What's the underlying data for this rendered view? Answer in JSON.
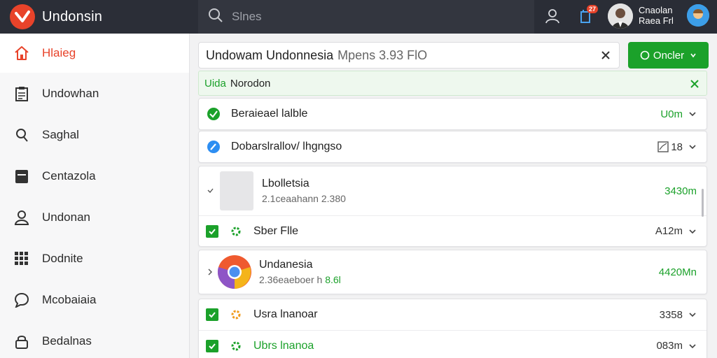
{
  "app": {
    "title": "Undonsin"
  },
  "search": {
    "placeholder": "Slnes"
  },
  "notifications": {
    "badge": "27"
  },
  "profile": {
    "line1": "Cnaolan",
    "line2": "Raea Frl"
  },
  "sidebar": {
    "items": [
      {
        "label": "Hlaieg",
        "icon": "home-icon",
        "active": true
      },
      {
        "label": "Undowhan",
        "icon": "clipboard-icon"
      },
      {
        "label": "Saghal",
        "icon": "search-icon"
      },
      {
        "label": "Centazola",
        "icon": "contacts-icon"
      },
      {
        "label": "Undonan",
        "icon": "user-icon"
      },
      {
        "label": "Dodnite",
        "icon": "grid-icon"
      },
      {
        "label": "Mcobaiaia",
        "icon": "chat-icon"
      },
      {
        "label": "Bedalnas",
        "icon": "lock-icon"
      }
    ]
  },
  "path_bar": {
    "name": "Undowam Undonnesia",
    "size": "Mpens 3.93 FlO"
  },
  "primary_button": {
    "label": "Oncler"
  },
  "notice": {
    "accent": "Uida",
    "text": "Norodon"
  },
  "rows": {
    "r1": {
      "label": "Beraieael lalble",
      "value": "U0m"
    },
    "r2": {
      "label": "Dobarslrallov/ lhgngso",
      "value": "18"
    },
    "r3": {
      "title": "Lbolletsia",
      "subtitle": "2.1ceaahann 2.380",
      "value": "3430m"
    },
    "r4": {
      "label": "Sber Flle",
      "value": "A12m"
    },
    "r5": {
      "title": "Undanesia",
      "subtitle_a": "2.36eaeboer h",
      "subtitle_b": "8.6l",
      "value": "4420Mn"
    },
    "r6": {
      "label": "Usra lnanoar",
      "value": "3358"
    },
    "r7": {
      "label": "Ubrs lnanoa",
      "value": "083m"
    }
  },
  "colors": {
    "brand": "#e8432a",
    "accent_green": "#1ba12a",
    "topbar": "#2a2d36"
  }
}
